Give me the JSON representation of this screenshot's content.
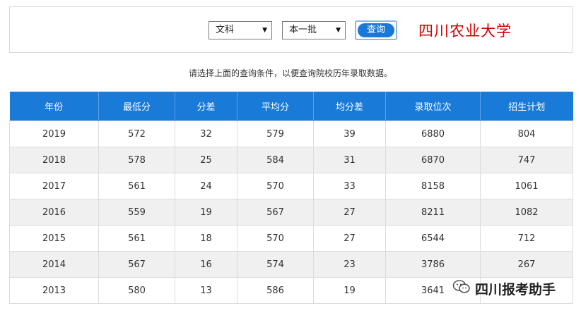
{
  "filters": {
    "subject_selected": "文科",
    "batch_selected": "本一批",
    "query_label": "查询"
  },
  "school_name": "四川农业大学",
  "hint": "请选择上面的查询条件，以便查询院校历年录取数据。",
  "table": {
    "columns": [
      "年份",
      "最低分",
      "分差",
      "平均分",
      "均分差",
      "录取位次",
      "招生计划"
    ],
    "rows": [
      [
        "2019",
        "572",
        "32",
        "579",
        "39",
        "6880",
        "804"
      ],
      [
        "2018",
        "578",
        "25",
        "584",
        "31",
        "6870",
        "747"
      ],
      [
        "2017",
        "561",
        "24",
        "570",
        "33",
        "8158",
        "1061"
      ],
      [
        "2016",
        "559",
        "19",
        "567",
        "27",
        "8211",
        "1082"
      ],
      [
        "2015",
        "561",
        "18",
        "570",
        "27",
        "6544",
        "712"
      ],
      [
        "2014",
        "567",
        "16",
        "574",
        "23",
        "3786",
        "267"
      ],
      [
        "2013",
        "580",
        "13",
        "586",
        "19",
        "3641",
        ""
      ]
    ]
  },
  "watermark": {
    "text": "四川报考助手",
    "icon": "wechat-icon"
  },
  "colors": {
    "header_bg": "#1a7ad8",
    "school_name": "#d40000",
    "stripe": "#f0f0f0",
    "button": "#1a78d9"
  }
}
